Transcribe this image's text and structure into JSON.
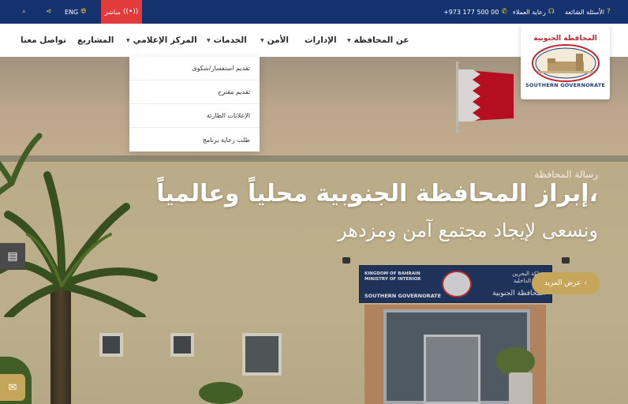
{
  "topbar": {
    "faq": "الأسئلة الشائعة",
    "customer_care": "رعاية العملاء",
    "phone": "+973 177 500 00",
    "live": "مباشر",
    "lang": "ENG",
    "icons": {
      "faq": "question-icon",
      "customer_care": "headset-icon",
      "phone": "phone-icon",
      "live": "broadcast-icon",
      "lang": "globe-icon",
      "share": "share-icon",
      "search": "search-icon"
    }
  },
  "nav": {
    "items": [
      {
        "label": "عن المحافظة",
        "has_dropdown": true
      },
      {
        "label": "الإدارات",
        "has_dropdown": false
      },
      {
        "label": "الأمن",
        "has_dropdown": true
      },
      {
        "label": "الخدمات",
        "has_dropdown": true
      },
      {
        "label": "المركز الإعلامي",
        "has_dropdown": true
      },
      {
        "label": "المشاريع",
        "has_dropdown": false
      },
      {
        "label": "تواصل معنا",
        "has_dropdown": false
      }
    ]
  },
  "logo": {
    "arabic": "المحافظة الجنوبية",
    "english": "SOUTHERN GOVERNORATE"
  },
  "dropdown": {
    "items": [
      "تقديم استفسار/شكوى",
      "تقديم مقترح",
      "الإعلانات الطارئة",
      "طلب رعاية برنامج"
    ]
  },
  "hero": {
    "label": "رسالة المحافظة",
    "title": "إبراز المحافظة الجنوبية محلياً وعالمياً،",
    "subtitle": "ونسعى لإيجاد مجتمع آمن ومزدهر",
    "more_button": "عرض المزيد"
  },
  "sign": {
    "english_line1": "KINGDOM OF BAHRAIN",
    "english_line2": "MINISTRY OF INTERIOR",
    "english_line3": "SOUTHERN GOVERNORATE",
    "arabic_line1": "مملكة البحرين",
    "arabic_line2": "وزارة الداخلية",
    "arabic_line3": "المحافظة الجنوبية"
  },
  "colors": {
    "topbar": "#14336e",
    "live": "#e23b3b",
    "accent": "#c5a65b",
    "flag_red": "#ce1126"
  }
}
